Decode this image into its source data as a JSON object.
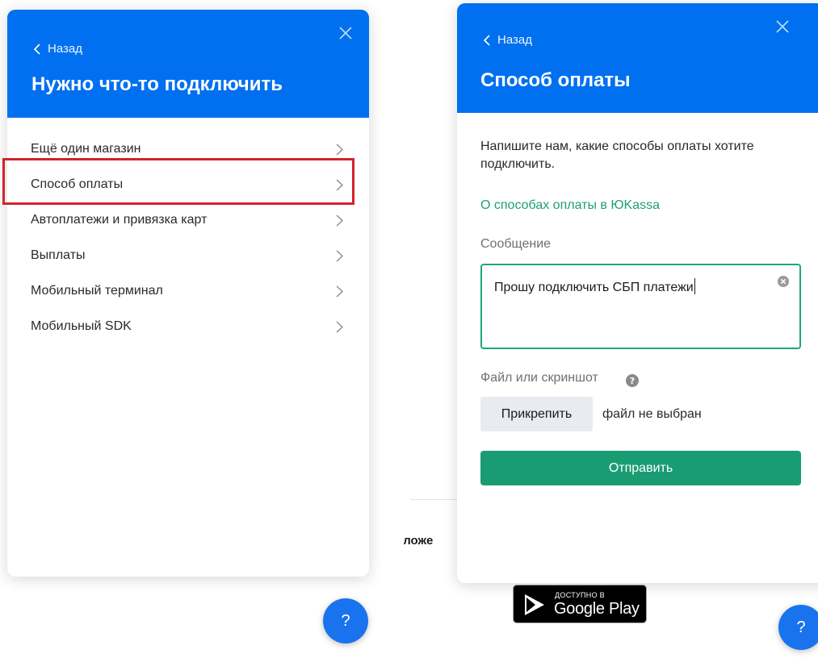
{
  "left_panel": {
    "back_label": "Назад",
    "title": "Нужно что-то подключить",
    "menu": [
      {
        "label": "Ещё один магазин"
      },
      {
        "label": "Способ оплаты"
      },
      {
        "label": "Автоплатежи и привязка карт"
      },
      {
        "label": "Выплаты"
      },
      {
        "label": "Мобильный терминал"
      },
      {
        "label": "Мобильный SDK"
      }
    ],
    "highlighted_item": "Способ оплаты"
  },
  "right_panel": {
    "back_label": "Назад",
    "title": "Способ оплаты",
    "intro": "Напишите нам, какие способы оплаты хотите подключить.",
    "link_label": "О способах оплаты в ЮKassa",
    "message_label": "Сообщение",
    "message_value": "Прошу подключить СБП платежи",
    "file_label": "Файл или скриншот",
    "attach_label": "Прикрепить",
    "no_file_text": "файл не выбран",
    "submit_label": "Отправить"
  },
  "background": {
    "apps_text": "иложе",
    "google_play_small": "ДОСТУПНО В",
    "google_play_big": "Google Play",
    "help_label": "?"
  },
  "colors": {
    "header_blue": "#0070f0",
    "accent_green": "#1a9c72",
    "highlight_red": "#d3232c",
    "help_blue": "#1a73ee"
  }
}
